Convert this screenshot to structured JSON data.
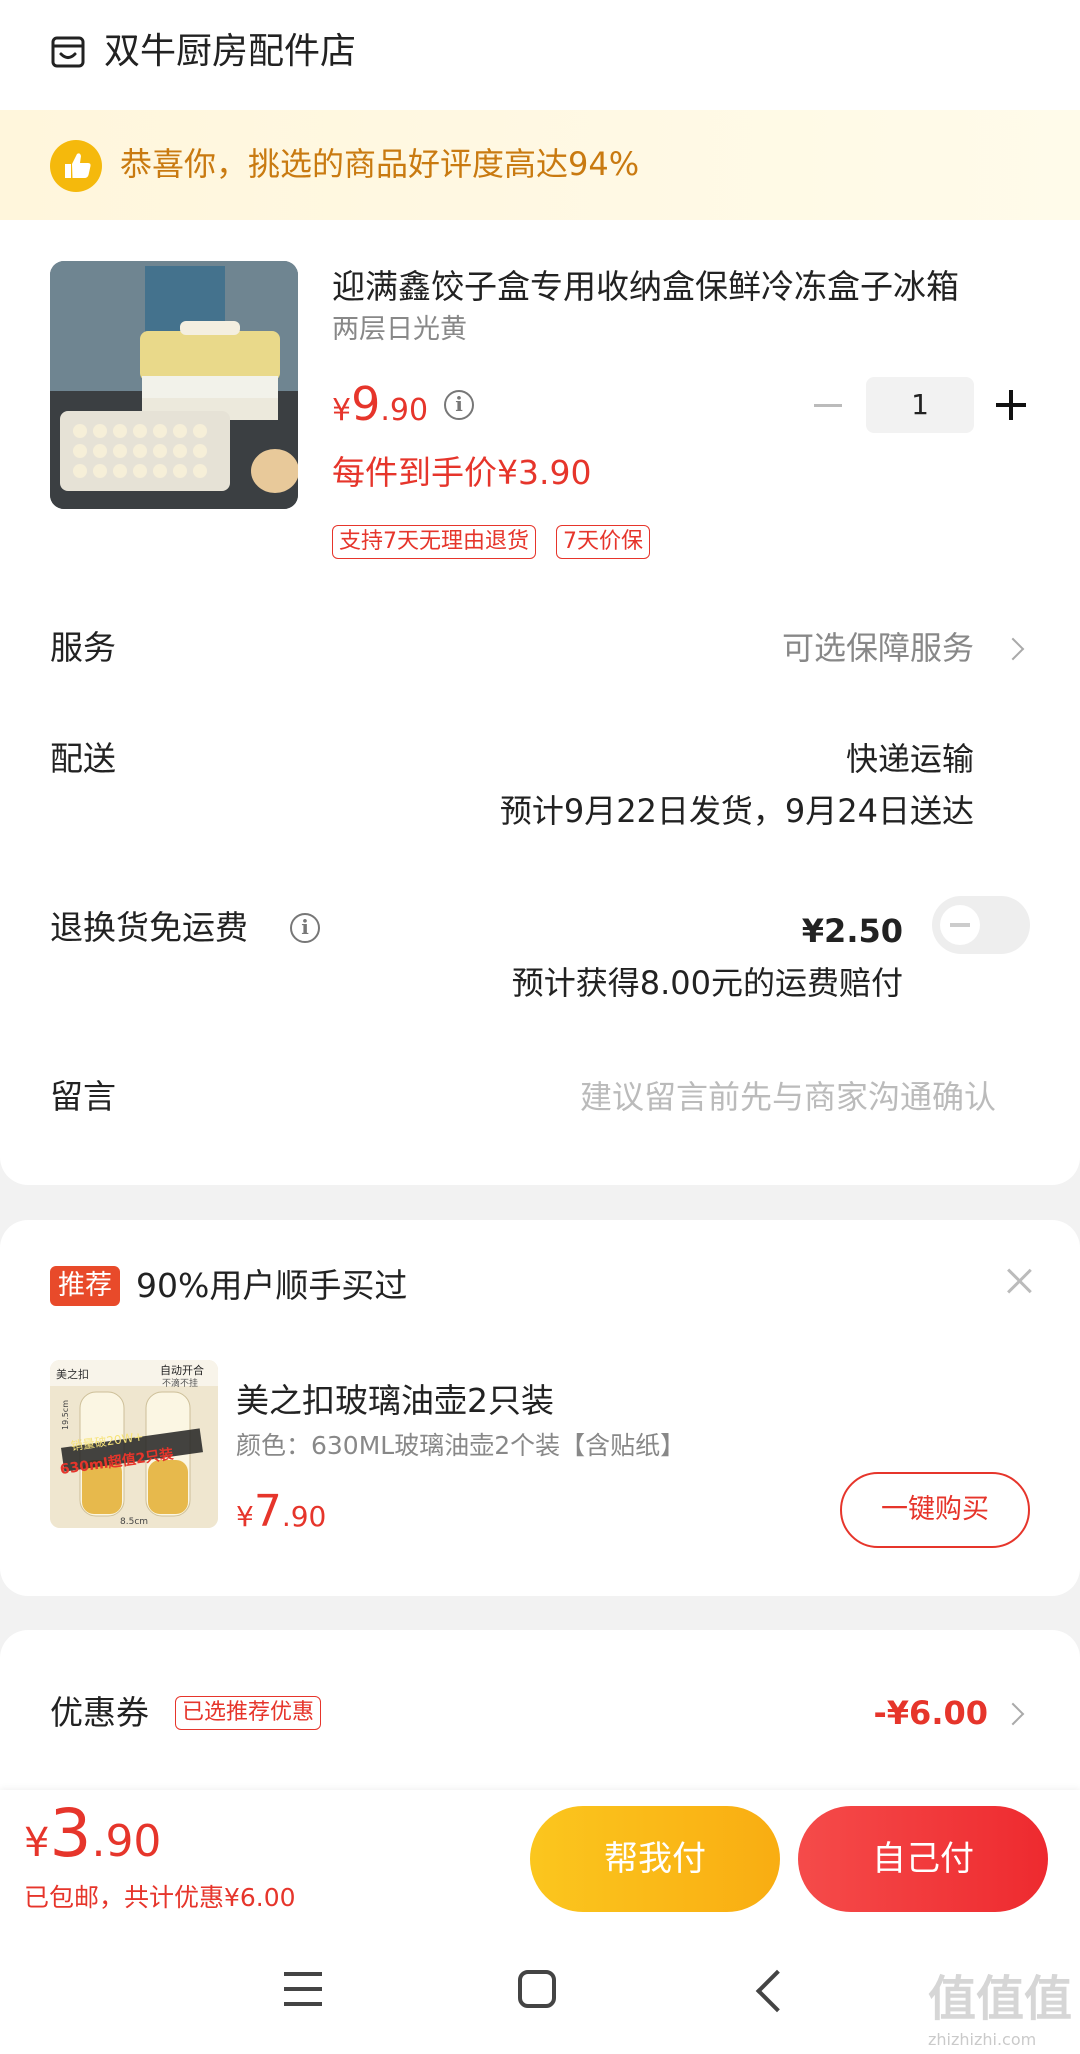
{
  "shop": {
    "name": "双牛厨房配件店",
    "icon": "shop-icon"
  },
  "banner": {
    "text": "恭喜你，挑选的商品好评度高达94%",
    "icon": "thumbs-up-icon"
  },
  "product": {
    "title": "迎满鑫饺子盒专用收纳盒保鲜冷冻盒子冰箱",
    "variant": "两层日光黄",
    "price_symbol": "¥",
    "price_int": "9",
    "price_dec": ".90",
    "deal_price": "每件到手价¥3.90",
    "tags": [
      "支持7天无理由退货",
      "7天价保"
    ],
    "quantity": "1"
  },
  "rows": {
    "service_label": "服务",
    "service_value": "可选保障服务",
    "delivery_label": "配送",
    "delivery_method": "快递运输",
    "delivery_estimate": "预计9月22日发货，9月24日送达",
    "return_label": "退换货免运费",
    "return_price": "¥2.50",
    "return_note": "预计获得8.00元的运费赔付",
    "return_toggle_on": false,
    "message_label": "留言",
    "message_placeholder": "建议留言前先与商家沟通确认"
  },
  "recommend": {
    "badge": "推荐",
    "title": "90%用户顺手买过",
    "item_name": "美之扣玻璃油壶2只装",
    "item_spec": "颜色：630ML玻璃油壶2个装【含贴纸】",
    "price_symbol": "¥",
    "price_int": "7",
    "price_dec": ".90",
    "buy_label": "一键购买",
    "img_texts": {
      "brand": "美之扣",
      "auto": "自动开合",
      "no_leak": "不滴不挂",
      "sales": "销量破20W+",
      "promo": "630ml超值2只装",
      "height": "19.5cm",
      "width": "8.5cm"
    }
  },
  "coupon": {
    "label": "优惠券",
    "tag": "已选推荐优惠",
    "amount": "-¥6.00"
  },
  "bottom": {
    "total_symbol": "¥",
    "total_int": "3",
    "total_dec": ".90",
    "total_sub": "已包邮，共计优惠¥6.00",
    "help_pay": "帮我付",
    "self_pay": "自己付"
  },
  "watermark": {
    "text": "值值值",
    "sub": "zhizhizhi.com"
  },
  "colors": {
    "accent_red": "#e6352b",
    "accent_yellow": "#f9ad12",
    "banner_text": "#c97a10"
  }
}
